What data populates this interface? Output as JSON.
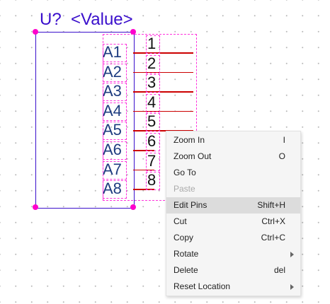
{
  "component": {
    "reference": "U?",
    "value": "<Value>",
    "pins": [
      {
        "name": "A1",
        "number": "1"
      },
      {
        "name": "A2",
        "number": "2"
      },
      {
        "name": "A3",
        "number": "3"
      },
      {
        "name": "A4",
        "number": "4"
      },
      {
        "name": "A5",
        "number": "5"
      },
      {
        "name": "A6",
        "number": "6"
      },
      {
        "name": "A7",
        "number": "7"
      },
      {
        "name": "A8",
        "number": "8"
      }
    ]
  },
  "context_menu": {
    "items": [
      {
        "label": "Zoom In",
        "shortcut": "I",
        "submenu": false,
        "disabled": false,
        "active": false
      },
      {
        "label": "Zoom Out",
        "shortcut": "O",
        "submenu": false,
        "disabled": false,
        "active": false
      },
      {
        "label": "Go To",
        "shortcut": "",
        "submenu": false,
        "disabled": false,
        "active": false
      },
      {
        "label": "Paste",
        "shortcut": "",
        "submenu": false,
        "disabled": true,
        "active": false
      },
      {
        "label": "Edit Pins",
        "shortcut": "Shift+H",
        "submenu": false,
        "disabled": false,
        "active": true
      },
      {
        "label": "Cut",
        "shortcut": "Ctrl+X",
        "submenu": false,
        "disabled": false,
        "active": false
      },
      {
        "label": "Copy",
        "shortcut": "Ctrl+C",
        "submenu": false,
        "disabled": false,
        "active": false
      },
      {
        "label": "Rotate",
        "shortcut": "",
        "submenu": true,
        "disabled": false,
        "active": false
      },
      {
        "label": "Delete",
        "shortcut": "del",
        "submenu": false,
        "disabled": false,
        "active": false
      },
      {
        "label": "Reset Location",
        "shortcut": "",
        "submenu": true,
        "disabled": false,
        "active": false
      }
    ]
  },
  "colors": {
    "component_outline": "#3a0fcc",
    "selection_handle": "#ff00cc",
    "pin_line": "#cc0000",
    "pin_name": "#1e3c80",
    "menu_highlight": "#dcdcdc"
  }
}
